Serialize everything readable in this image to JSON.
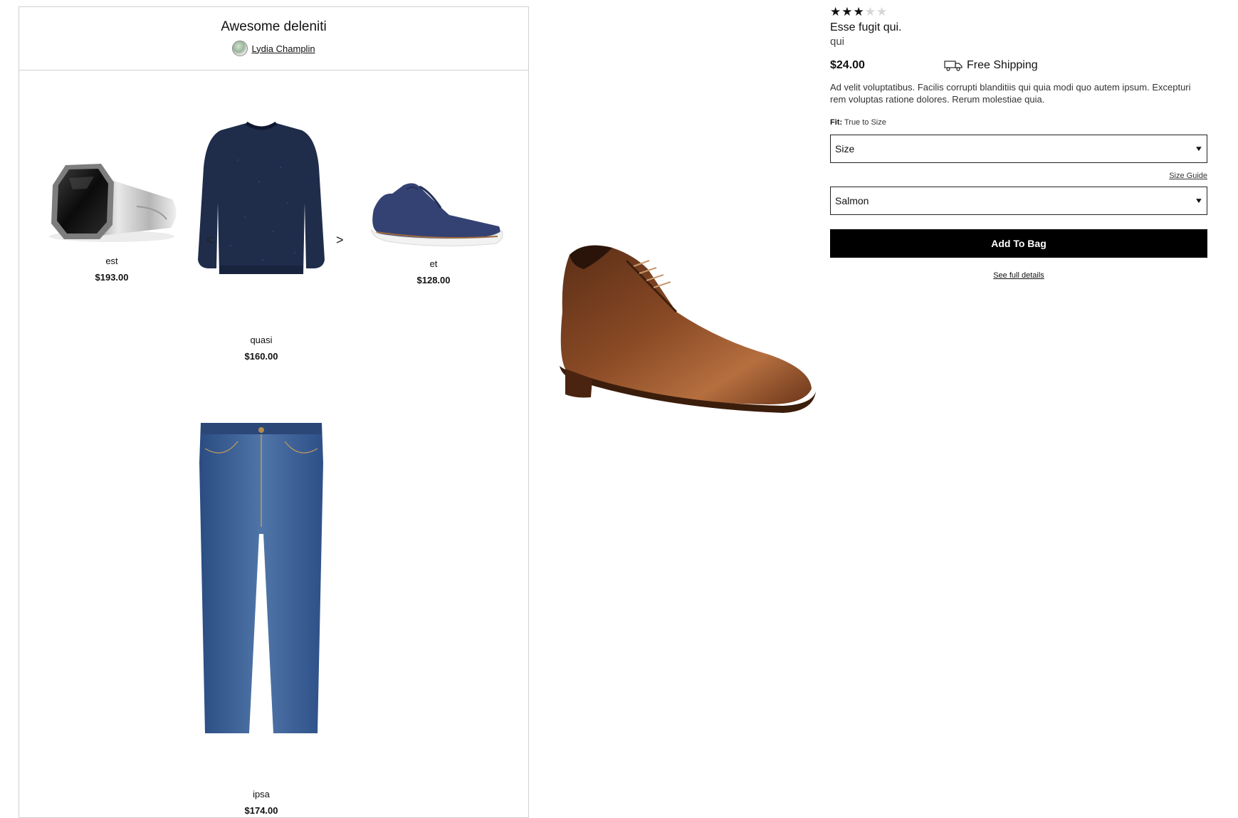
{
  "outfit": {
    "title": "Awesome deleniti",
    "author": "Lydia Champlin",
    "items": {
      "ring": {
        "name": "est",
        "price": "$193.00"
      },
      "sweater": {
        "name": "quasi",
        "price": "$160.00"
      },
      "shoe": {
        "name": "et",
        "price": "$128.00"
      },
      "jeans": {
        "name": "ipsa",
        "price": "$174.00"
      }
    },
    "carousel": {
      "prev": "<",
      "next": ">"
    }
  },
  "product": {
    "rating": 3,
    "rating_max": 5,
    "name": "Esse fugit qui.",
    "brand": "qui",
    "price": "$24.00",
    "shipping": "Free Shipping",
    "description": "Ad velit voluptatibus. Facilis corrupti blanditiis qui quia modi quo autem ipsum. Excepturi rem voluptas ratione dolores. Rerum molestiae quia.",
    "fit_label": "Fit:",
    "fit_value": "True to Size",
    "size_select": "Size",
    "size_guide": "Size Guide",
    "color_select": "Salmon",
    "add_to_bag": "Add To Bag",
    "full_details": "See full details"
  },
  "icons": {
    "rating": "star-icon",
    "shipping": "truck-icon",
    "dropdown": "chevron-down-icon",
    "avatar": "avatar-icon"
  }
}
